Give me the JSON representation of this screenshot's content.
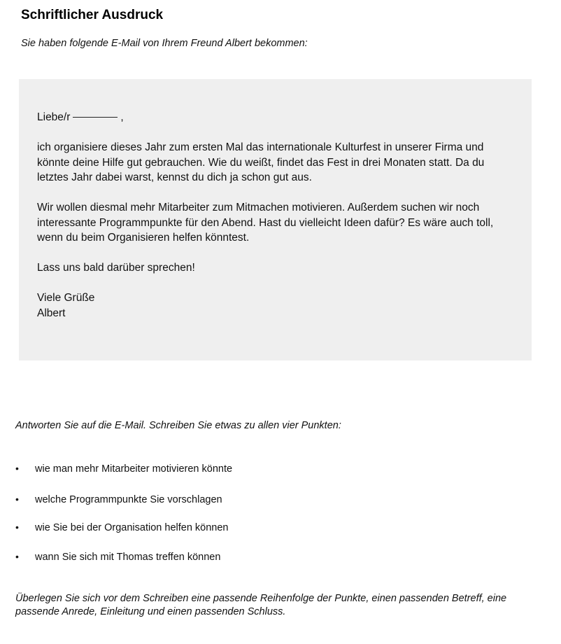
{
  "header": {
    "title": "Schriftlicher Ausdruck",
    "intro": "Sie haben folgende E-Mail von Ihrem Freund Albert bekommen:"
  },
  "email": {
    "salutation_prefix": "Liebe/r",
    "salutation_suffix": ",",
    "paragraph_1": "ich organisiere dieses Jahr zum ersten Mal das internationale Kulturfest in unserer Firma und könnte deine Hilfe gut gebrauchen. Wie du weißt, findet das Fest in drei Monaten statt. Da du letztes Jahr dabei warst, kennst du dich ja schon gut aus.",
    "paragraph_2": "Wir wollen diesmal mehr Mitarbeiter zum Mitmachen motivieren. Außerdem suchen wir noch interessante Programmpunkte für den Abend. Hast du vielleicht Ideen dafür? Es wäre auch toll, wenn du beim Organisieren helfen könntest.",
    "paragraph_3": "Lass uns bald darüber sprechen!",
    "closing": "Viele Grüße",
    "signature": "Albert"
  },
  "task": {
    "instruction": "Antworten Sie auf die E-Mail. Schreiben Sie etwas zu allen vier Punkten:",
    "bullet_symbol": "•",
    "points": [
      "wie man mehr Mitarbeiter motivieren könnte",
      "welche Programmpunkte Sie vorschlagen",
      "wie Sie bei der Organisation helfen können",
      "wann Sie sich mit Thomas treffen können"
    ],
    "outro": "Überlegen Sie sich vor dem Schreiben eine passende Reihenfolge der Punkte, einen passenden Betreff, eine passende Anrede, Einleitung und einen passenden Schluss."
  },
  "colors": {
    "email_background": "#efefef",
    "text": "#111111"
  }
}
